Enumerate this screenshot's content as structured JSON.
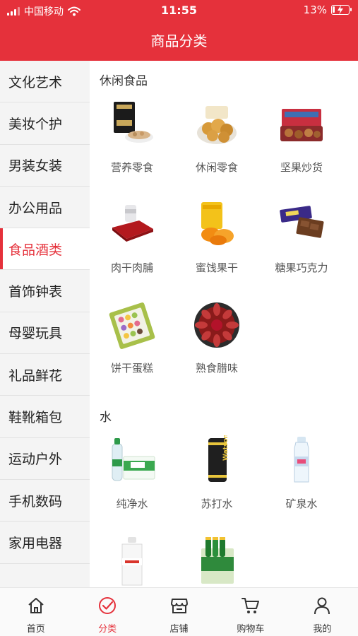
{
  "status": {
    "carrier": "中国移动",
    "time": "11:55",
    "battery_text": "13%",
    "battery_level": 0.13
  },
  "header": {
    "title": "商品分类"
  },
  "colors": {
    "brand": "#e5313b"
  },
  "sidebar": {
    "items": [
      {
        "label": "文化艺术"
      },
      {
        "label": "美妆个护"
      },
      {
        "label": "男装女装"
      },
      {
        "label": "办公用品"
      },
      {
        "label": "食品酒类",
        "active": true
      },
      {
        "label": "首饰钟表"
      },
      {
        "label": "母婴玩具"
      },
      {
        "label": "礼品鲜花"
      },
      {
        "label": "鞋靴箱包"
      },
      {
        "label": "运动户外"
      },
      {
        "label": "手机数码"
      },
      {
        "label": "家用电器"
      },
      {
        "label": ""
      }
    ]
  },
  "sections": [
    {
      "title": "休闲食品",
      "items": [
        {
          "label": "营养零食",
          "icon": "nutrition-snack-image"
        },
        {
          "label": "休闲零食",
          "icon": "leisure-snack-image"
        },
        {
          "label": "坚果炒货",
          "icon": "nuts-image"
        },
        {
          "label": "肉干肉脯",
          "icon": "jerky-image"
        },
        {
          "label": "蜜饯果干",
          "icon": "dried-fruit-image"
        },
        {
          "label": "糖果巧克力",
          "icon": "chocolate-image"
        },
        {
          "label": "饼干蛋糕",
          "icon": "biscuit-image"
        },
        {
          "label": "熟食腊味",
          "icon": "cured-meat-image"
        }
      ]
    },
    {
      "title": "水",
      "items": [
        {
          "label": "纯净水",
          "icon": "purified-water-image"
        },
        {
          "label": "苏打水",
          "icon": "soda-water-image"
        },
        {
          "label": "矿泉水",
          "icon": "mineral-water-image"
        },
        {
          "label": "",
          "icon": "water-bucket-image"
        },
        {
          "label": "",
          "icon": "sparkling-water-image"
        }
      ]
    }
  ],
  "tabbar": {
    "items": [
      {
        "label": "首页",
        "icon": "home-icon"
      },
      {
        "label": "分类",
        "icon": "category-check-icon",
        "active": true
      },
      {
        "label": "店铺",
        "icon": "store-icon"
      },
      {
        "label": "购物车",
        "icon": "cart-icon"
      },
      {
        "label": "我的",
        "icon": "profile-icon"
      }
    ]
  }
}
